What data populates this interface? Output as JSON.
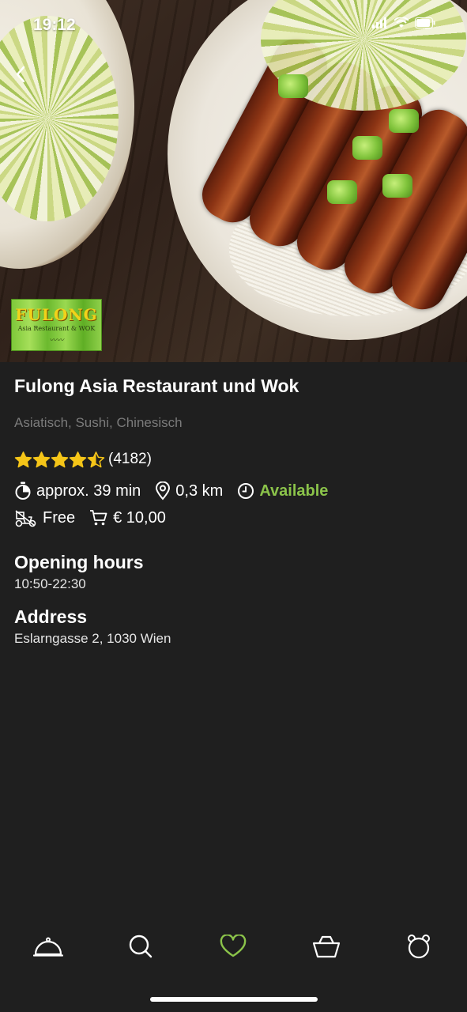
{
  "status_bar": {
    "time": "19:12"
  },
  "restaurant": {
    "name": "Fulong Asia Restaurant und Wok",
    "cuisines": "Asiatisch, Sushi, Chinesisch",
    "rating": 4.5,
    "rating_count": "(4182)",
    "delivery_time": "approx. 39 min",
    "distance": "0,3 km",
    "availability": "Available",
    "delivery_fee": "Free",
    "min_order": "€ 10,00"
  },
  "logo": {
    "title": "FULONG",
    "subtitle": "Asia Restaurant & WOK"
  },
  "opening_hours": {
    "title": "Opening hours",
    "value": "10:50-22:30"
  },
  "address": {
    "title": "Address",
    "value": "Eslarngasse 2, 1030 Wien"
  },
  "nav": [
    {
      "icon": "cloche-icon"
    },
    {
      "icon": "search-icon"
    },
    {
      "icon": "heart-icon"
    },
    {
      "icon": "basket-icon"
    },
    {
      "icon": "profile-bear-icon"
    }
  ],
  "colors": {
    "accent": "#8bc34a",
    "star": "#f5c518",
    "background": "#1f1f1f",
    "muted_text": "#7b7b7b"
  }
}
